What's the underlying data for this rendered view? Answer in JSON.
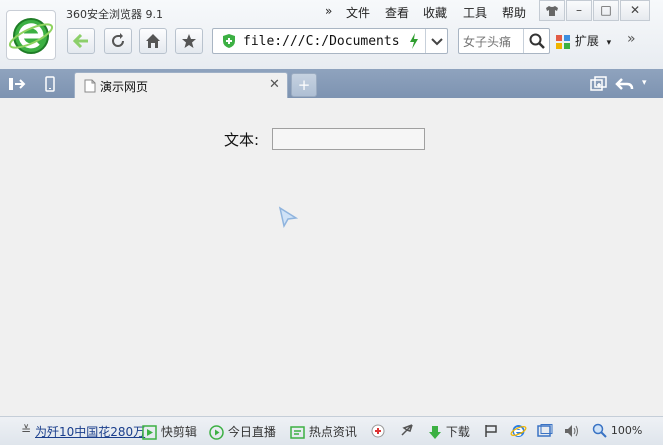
{
  "app": {
    "title": "360安全浏览器 9.1"
  },
  "menu": {
    "more": "»",
    "file": "文件",
    "view": "查看",
    "favorites": "收藏",
    "tools": "工具",
    "help": "帮助"
  },
  "window_controls": {
    "skin": "👕",
    "minimize": "–",
    "maximize": "□",
    "close": "✕"
  },
  "address": {
    "url": "file:///C:/Documents"
  },
  "search": {
    "placeholder": "女子头痛"
  },
  "extensions": {
    "label": "扩展",
    "more": "»"
  },
  "tabs": [
    {
      "title": "演示网页"
    }
  ],
  "page": {
    "text_label": "文本:",
    "text_value": ""
  },
  "status": {
    "news": "为歼10中国花280万",
    "quick_clip": "快剪辑",
    "live": "今日直播",
    "hot_news": "热点资讯",
    "download": "下载",
    "zoom": "100%"
  },
  "colors": {
    "accent": "#2f9e2f",
    "tab_strip": "#8fa3be",
    "link": "#1a3e8c"
  }
}
